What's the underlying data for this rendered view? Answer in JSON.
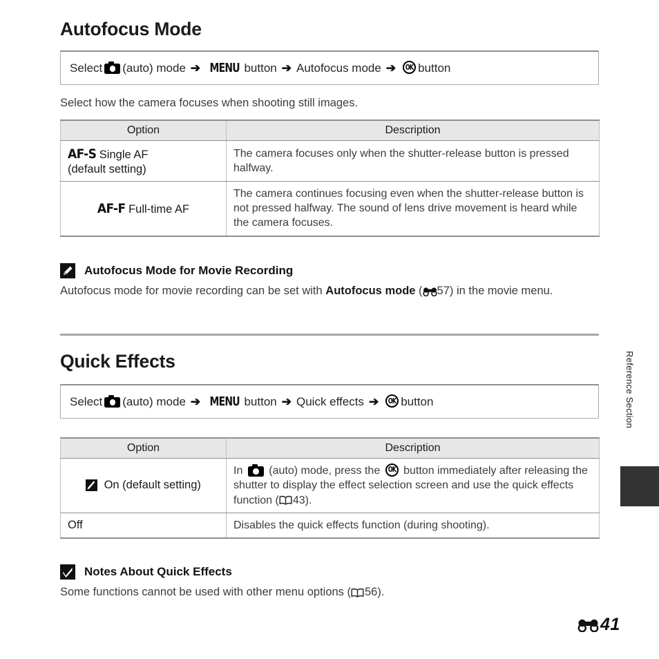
{
  "document": {
    "page_label": "41",
    "page_marker_icon": "reference-section-bone-icon",
    "side_tab_label": "Reference Section"
  },
  "sections": [
    {
      "id": "autofocus-mode",
      "title": "Autofocus Mode",
      "nav_path": {
        "lead": "Select",
        "camera_icon": "camera-icon",
        "mode_text": "(auto) mode",
        "menu_icon_label": "MENU",
        "menu_button_text": "button",
        "item_text": "Autofocus mode",
        "ok_icon_label": "OK",
        "ok_button_text": "button",
        "arrow": "➔"
      },
      "intro": "Select how the camera focuses when shooting still images.",
      "table": {
        "headers": [
          "Option",
          "Description"
        ],
        "rows": [
          {
            "code": "AF-S",
            "label": "Single AF",
            "sub": "(default setting)",
            "description": "The camera focuses only when the shutter-release button is pressed halfway."
          },
          {
            "code": "AF-F",
            "label": "Full-time AF",
            "sub": "",
            "description": "The camera continues focusing even when the shutter-release button is not pressed halfway. The sound of lens drive movement is heard while the camera focuses."
          }
        ]
      },
      "note": {
        "icon": "pencil-note-icon",
        "title": "Autofocus Mode for Movie Recording",
        "body_pre": "Autofocus mode for movie recording can be set with ",
        "body_bold": "Autofocus mode",
        "body_ref_open": " (",
        "body_ref_icon": "reference-section-bone-icon",
        "body_ref_num": "57",
        "body_post": ") in the movie menu."
      }
    },
    {
      "id": "quick-effects",
      "title": "Quick Effects",
      "nav_path": {
        "lead": "Select",
        "camera_icon": "camera-icon",
        "mode_text": "(auto) mode",
        "menu_icon_label": "MENU",
        "menu_button_text": "button",
        "item_text": "Quick effects",
        "ok_icon_label": "OK",
        "ok_button_text": "button",
        "arrow": "➔"
      },
      "table": {
        "headers": [
          "Option",
          "Description"
        ],
        "rows": [
          {
            "icon": "quick-effects-icon",
            "label": "On (default setting)",
            "desc_parts": {
              "p1": "In ",
              "camera_icon": "camera-icon",
              "p2": " (auto) mode, press the ",
              "ok_icon": "OK",
              "p3": " button immediately after releasing the shutter to display the effect selection screen and use the quick effects function (",
              "book_icon": "manual-reference-book-icon",
              "ref_num": "43",
              "p4": ")."
            }
          },
          {
            "icon": "",
            "label": "Off",
            "description": "Disables the quick effects function (during shooting)."
          }
        ]
      },
      "note": {
        "icon": "caution-check-note-icon",
        "title": "Notes About Quick Effects",
        "body_pre": "Some functions cannot be used with other menu options (",
        "body_ref_icon": "manual-reference-book-icon",
        "body_ref_num": "56",
        "body_post": ")."
      }
    }
  ],
  "colors": {
    "text": "#3c3c3c",
    "heading": "#1a1a1a",
    "rule": "#a6a6a6",
    "table_header_bg": "#e7e7e7",
    "table_border": "#8f8f8f",
    "side_tab": "#333333"
  }
}
